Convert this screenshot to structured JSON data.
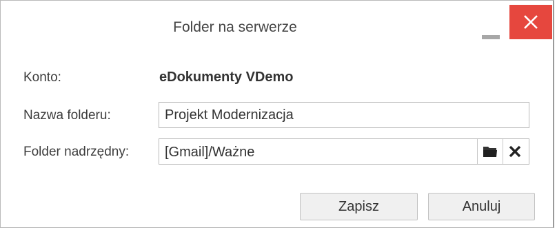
{
  "dialog": {
    "title": "Folder na serwerze",
    "minimize_icon": "minimize-icon",
    "close_icon": "close-icon",
    "close_color": "#e6473e"
  },
  "form": {
    "account_label": "Konto:",
    "account_value": "eDokumenty VDemo",
    "folder_name_label": "Nazwa folderu:",
    "folder_name_value": "Projekt Modernizacja",
    "parent_folder_label": "Folder nadrzędny:",
    "parent_folder_value": "[Gmail]/Ważne",
    "browse_icon": "folder-icon",
    "clear_icon": "clear-x-icon"
  },
  "buttons": {
    "save_label": "Zapisz",
    "cancel_label": "Anuluj"
  }
}
